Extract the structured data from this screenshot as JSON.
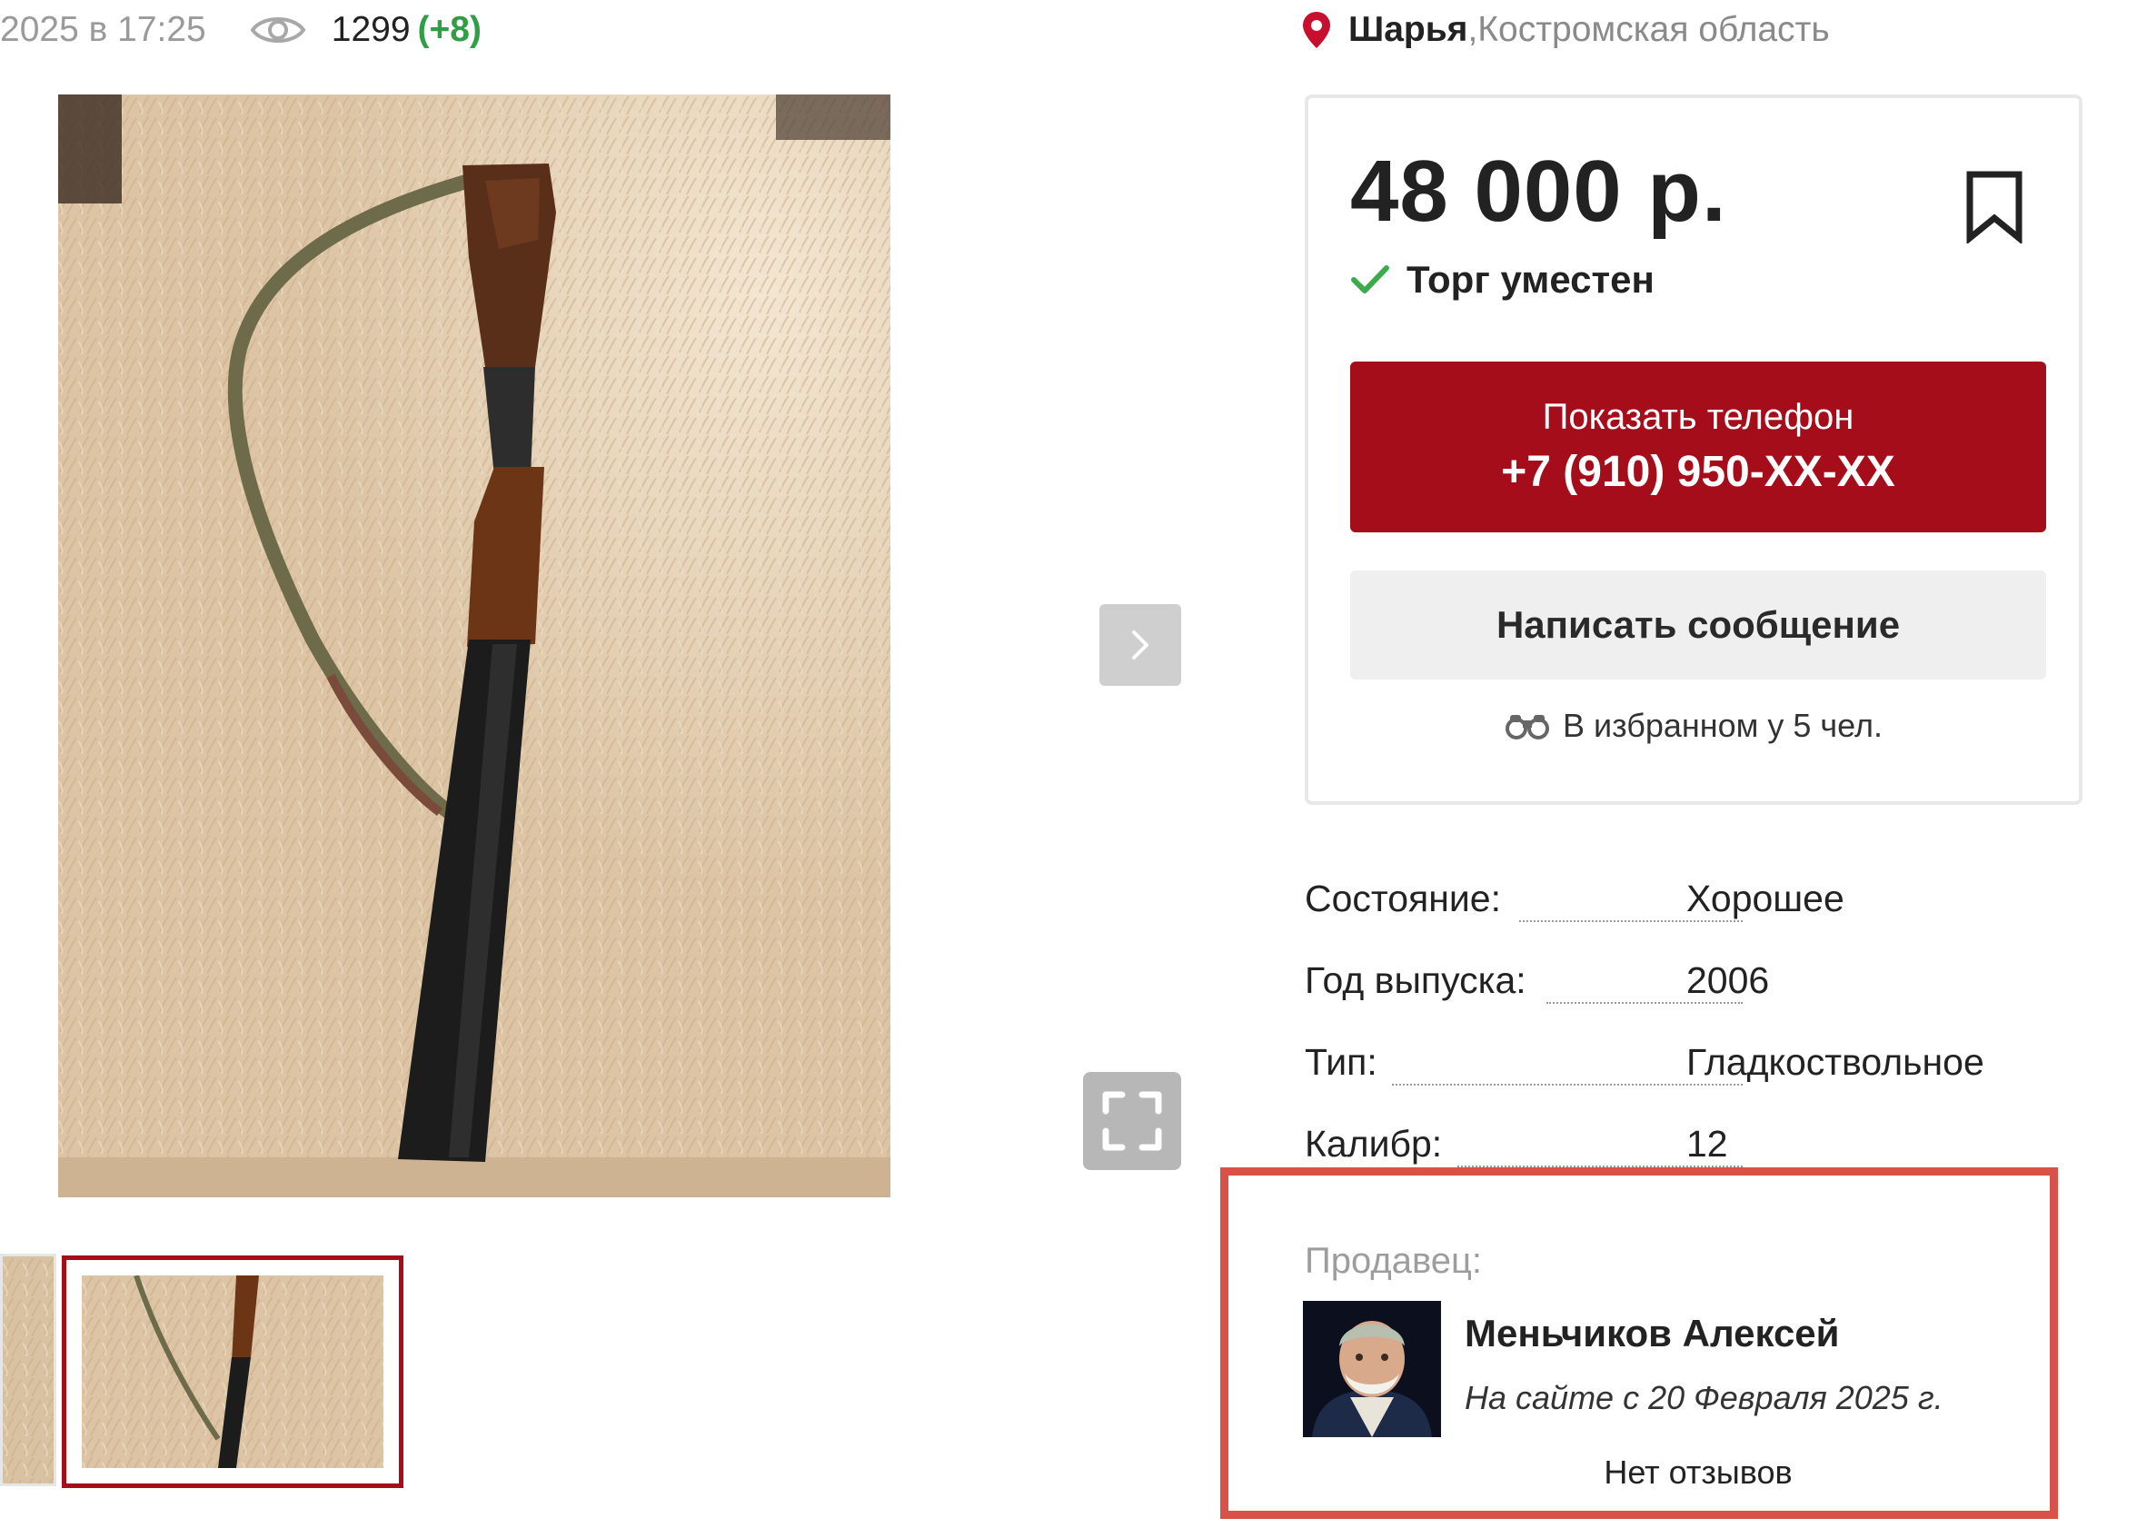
{
  "meta": {
    "date_text": "2025 в 17:25",
    "icon": "eye-icon",
    "views": "1299",
    "views_delta": "(+8)"
  },
  "location": {
    "icon": "map-pin-icon",
    "city": "Шарья",
    "separator": ", ",
    "region": "Костромская область"
  },
  "gallery": {
    "main_photo": "shotgun-on-rug-photo",
    "next_icon": "chevron-right-icon",
    "fullscreen_icon": "fullscreen-icon",
    "active_thumbnail_index": 1
  },
  "price_card": {
    "price": "48 000 р.",
    "bookmark_icon": "bookmark-icon",
    "bargain_label": "Торг уместен",
    "show_phone_label": "Показать телефон",
    "phone_masked": "+7 (910) 950-XX-XX",
    "message_button_label": "Написать сообщение",
    "favorites_text": "В избранном у 5 чел."
  },
  "specs": [
    {
      "key": "Состояние:",
      "value": "Хорошее"
    },
    {
      "key": "Год выпуска:",
      "value": "2006"
    },
    {
      "key": "Тип:",
      "value": "Гладкоствольное"
    },
    {
      "key": "Калибр:",
      "value": "12"
    }
  ],
  "seller": {
    "label": "Продавец:",
    "name": "Меньчиков Алексей",
    "since": "На сайте с 20 Февраля 2025 г.",
    "reviews": "Нет отзывов"
  },
  "colors": {
    "accent_red": "#a50d1a",
    "highlight_border": "#d9524a",
    "positive_green": "#2f9e44"
  }
}
